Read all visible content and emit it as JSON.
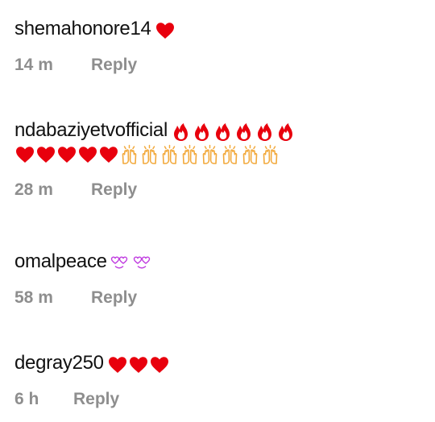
{
  "comments": [
    {
      "username": "shemahonore14",
      "emojis": [
        "red-heart"
      ],
      "time": "14 m",
      "reply_label": "Reply"
    },
    {
      "username": "ndabaziyetvofficial",
      "emojis": [
        "fire",
        "fire",
        "fire",
        "fire",
        "fire",
        "fire"
      ],
      "emojis_line2": [
        "red-heart",
        "red-heart",
        "red-heart",
        "red-heart",
        "red-heart",
        "clapping-hands",
        "clapping-hands",
        "clapping-hands",
        "clapping-hands",
        "clapping-hands",
        "clapping-hands",
        "clapping-hands",
        "clapping-hands"
      ],
      "time": "28 m",
      "reply_label": "Reply"
    },
    {
      "username": "omalpeace",
      "emojis": [
        "purple-heart-eyes",
        "purple-heart-eyes"
      ],
      "time": "58 m",
      "reply_label": "Reply"
    },
    {
      "username": "degray250",
      "emojis": [
        "red-heart",
        "red-heart",
        "red-heart"
      ],
      "time": "6 h",
      "reply_label": "Reply"
    }
  ],
  "colors": {
    "text": "#111111",
    "meta": "#8e8e8e",
    "heart": "#e8000d",
    "fire": "#e8000d",
    "clap": "#f2a93b",
    "purple": "#c03de0"
  }
}
